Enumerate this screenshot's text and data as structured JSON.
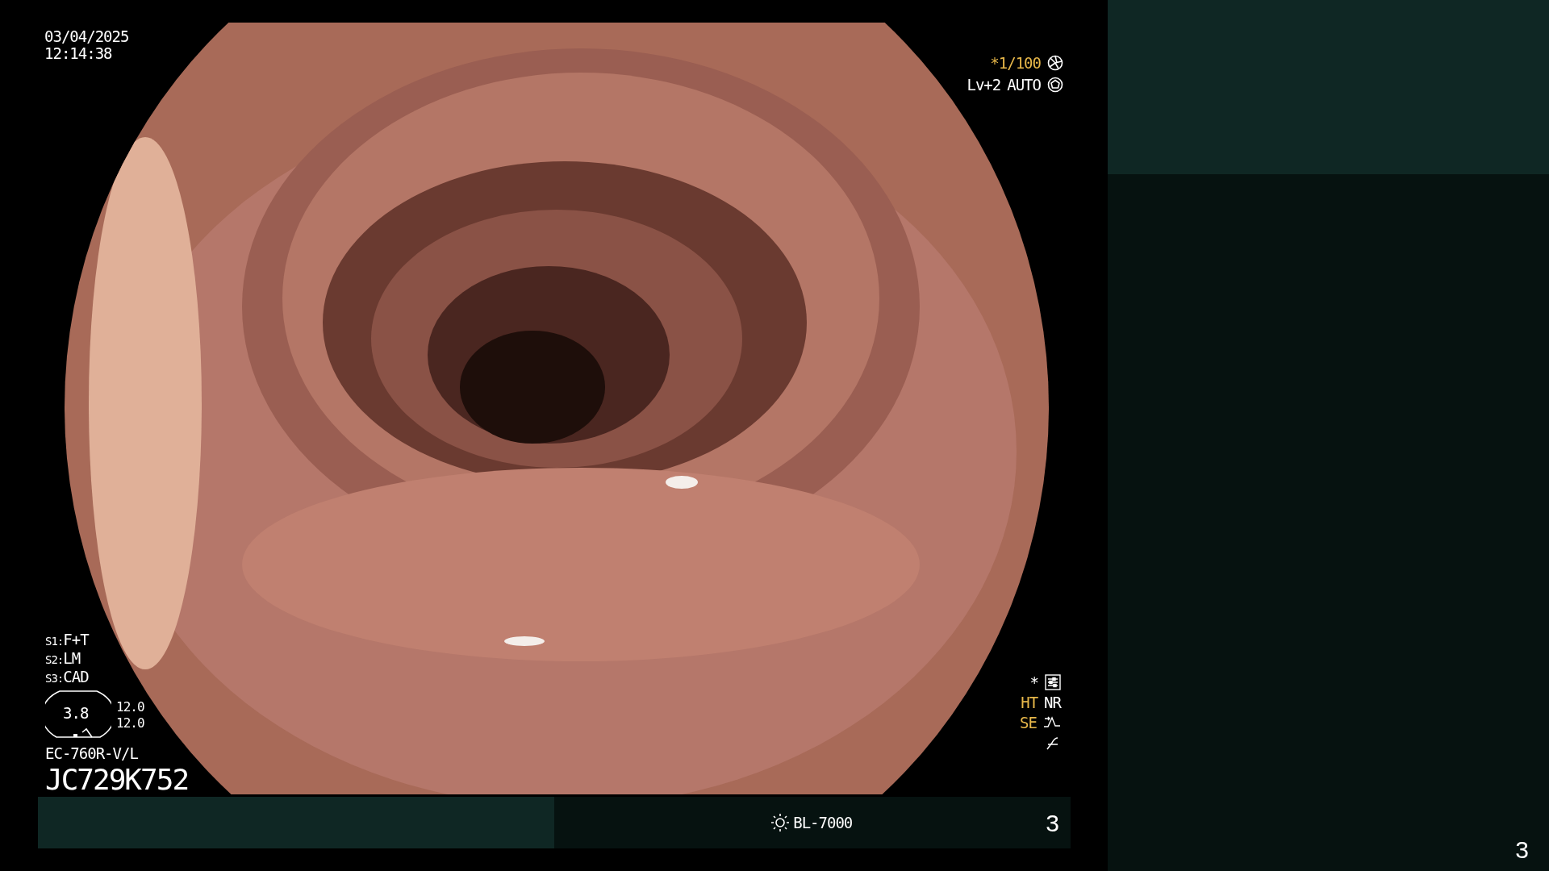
{
  "overlay": {
    "date": "03/04/2025",
    "time": "12:14:38",
    "shutter": "*1/100",
    "exposure": "Lv+2",
    "exposure_mode": "AUTO",
    "switches": [
      {
        "label": "S1:",
        "value": "F+T"
      },
      {
        "label": "S2:",
        "value": "LM"
      },
      {
        "label": "S3:",
        "value": "CAD"
      }
    ],
    "gauge": {
      "value": "3.8",
      "readings": [
        "12.0",
        "12.0"
      ]
    },
    "scope_model": "EC-760R-V/L",
    "scope_serial": "JC729K752",
    "star_mark": "*",
    "indicators": [
      {
        "label": "HT",
        "color": "#e8b84a"
      },
      {
        "label": "NR",
        "color": "#ffffff"
      }
    ],
    "edge": {
      "label": "SE",
      "color": "#e8b84a"
    }
  },
  "status_bar": {
    "light_source": "BL-7000",
    "page": "3"
  },
  "side_panel": {
    "page": "3"
  }
}
